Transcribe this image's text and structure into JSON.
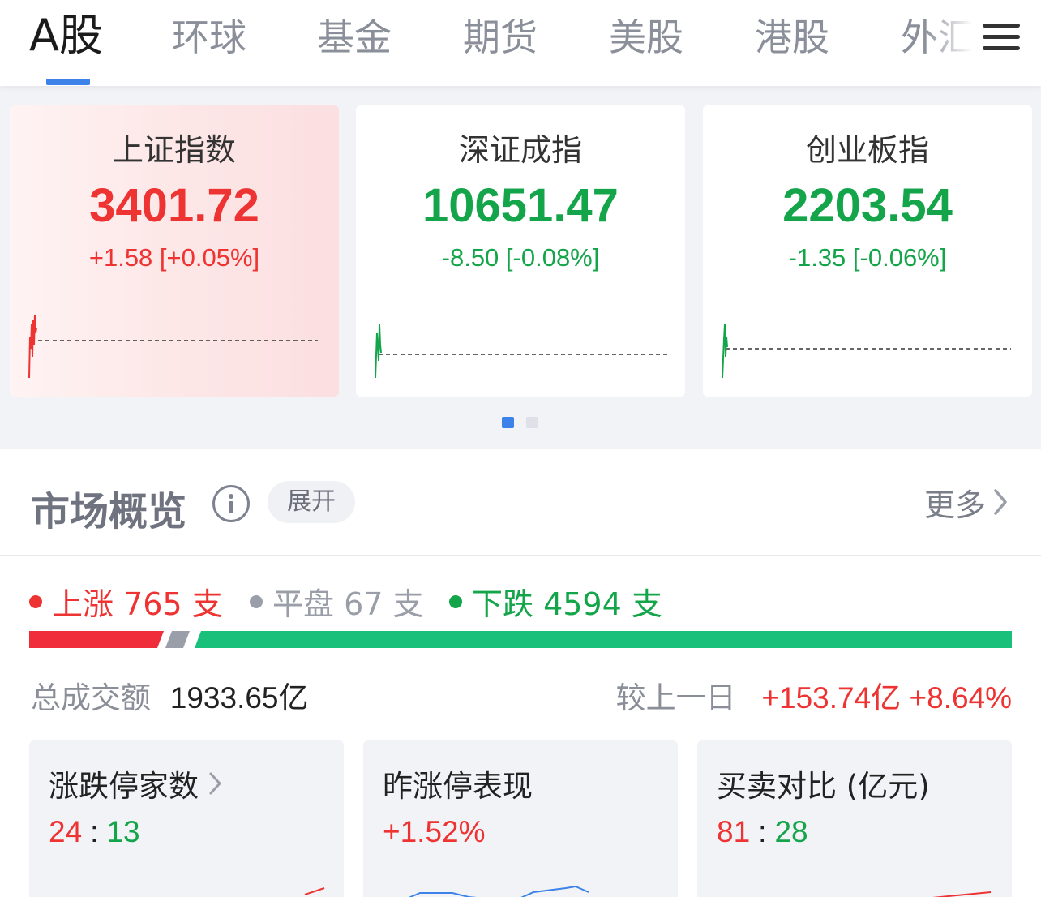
{
  "tabs": [
    {
      "label": "A股",
      "active": true
    },
    {
      "label": "环球"
    },
    {
      "label": "基金"
    },
    {
      "label": "期货"
    },
    {
      "label": "美股"
    },
    {
      "label": "港股"
    },
    {
      "label": "外汇"
    }
  ],
  "indices": [
    {
      "name": "上证指数",
      "value": "3401.72",
      "change": "+1.58 [+0.05%]",
      "direction": "up"
    },
    {
      "name": "深证成指",
      "value": "10651.47",
      "change": "-8.50 [-0.08%]",
      "direction": "down"
    },
    {
      "name": "创业板指",
      "value": "2203.54",
      "change": "-1.35 [-0.06%]",
      "direction": "down"
    }
  ],
  "pager": {
    "pages": 2,
    "active": 0
  },
  "overview": {
    "title": "市场概览",
    "info_icon": "info-circle-icon",
    "expand_label": "展开",
    "more_label": "更多",
    "counts": {
      "up": "上涨 765 支",
      "flat": "平盘 67 支",
      "down": "下跌 4594 支"
    },
    "breadth": {
      "up": 765,
      "flat": 67,
      "down": 4594
    },
    "turnover": {
      "label": "总成交额",
      "value": "1933.65亿",
      "compare_label": "较上一日",
      "compare_change": "+153.74亿 +8.64%"
    },
    "cards": [
      {
        "title": "涨跌停家数",
        "has_arrow": true,
        "left": "24",
        "right": "13"
      },
      {
        "title": "昨涨停表现",
        "value": "+1.52%"
      },
      {
        "title": "买卖对比 (亿元)",
        "left": "81",
        "right": "28"
      }
    ]
  },
  "colors": {
    "up": "#ee3333",
    "down": "#14a54a",
    "accent": "#3d82e8",
    "breadth_down": "#18c07a",
    "flat": "#9a9ea8"
  }
}
